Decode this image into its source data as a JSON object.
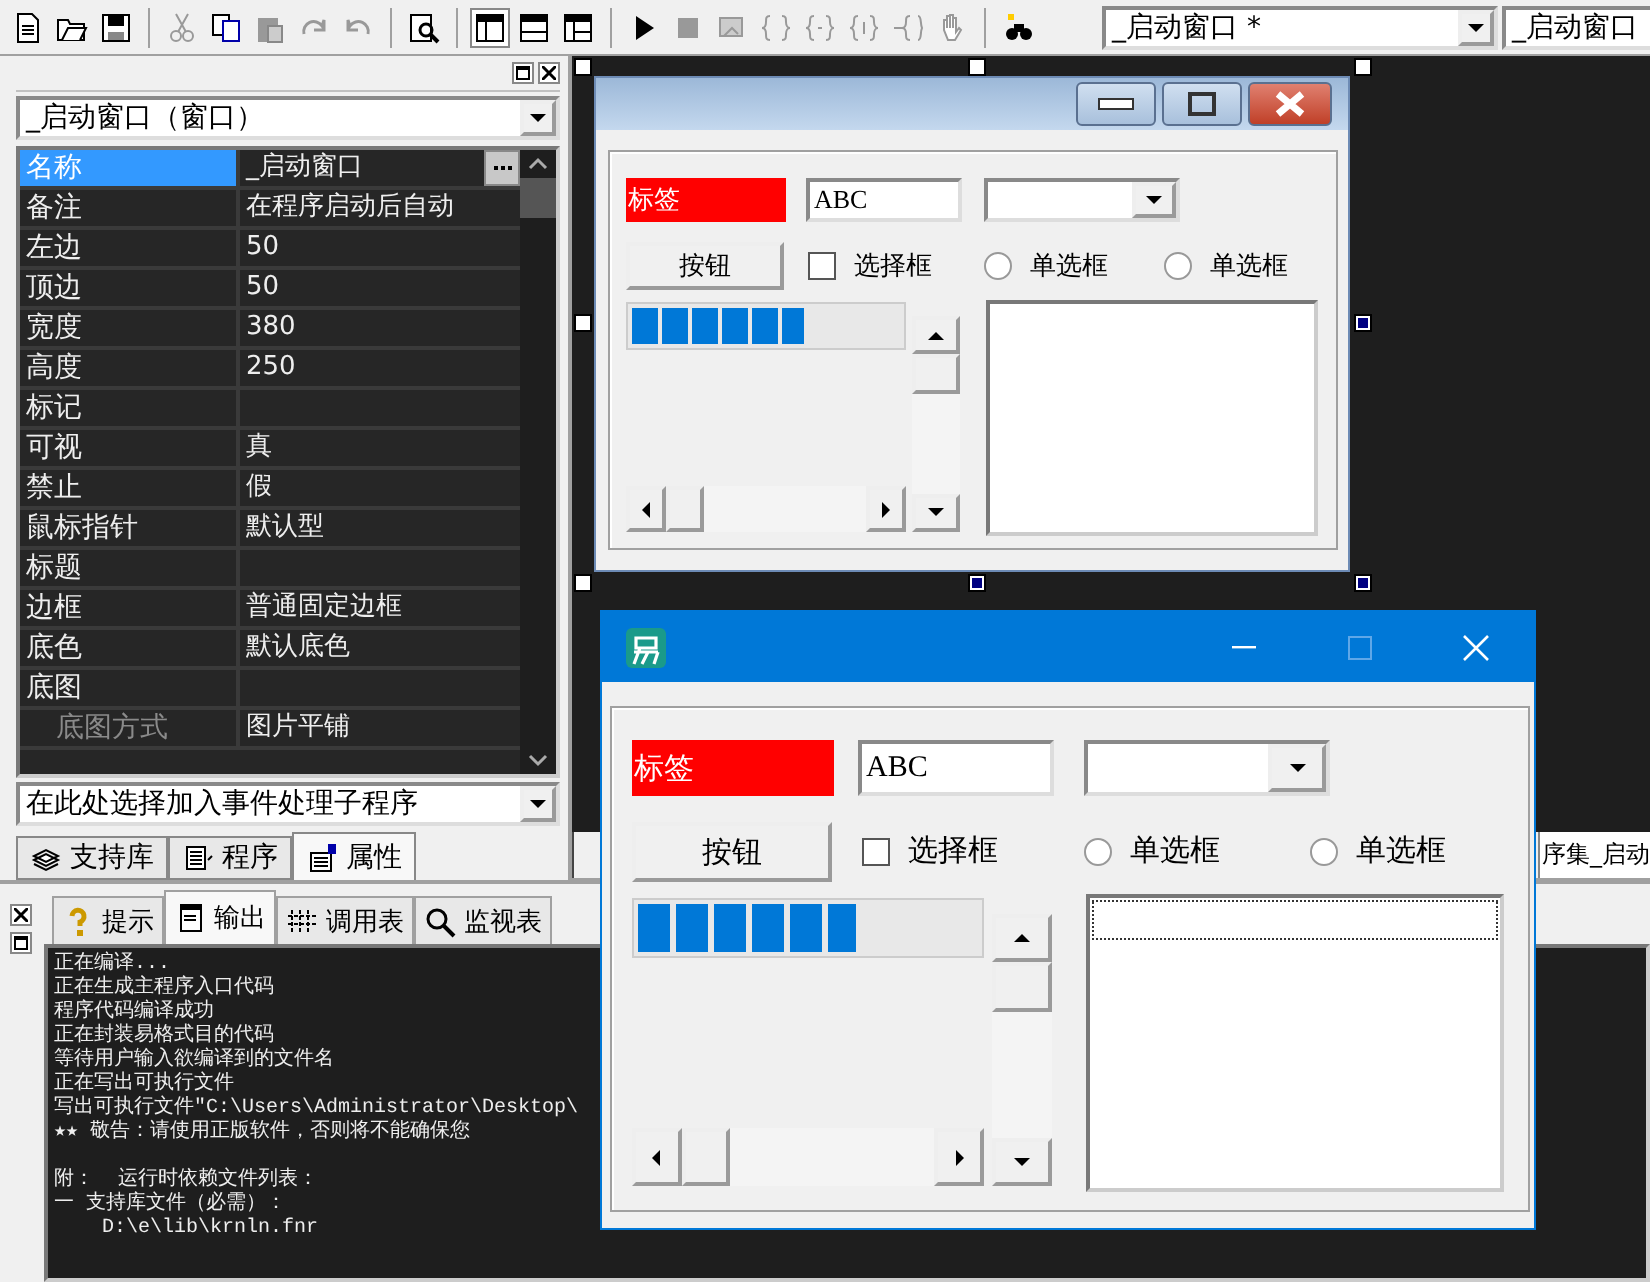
{
  "toolbar": {
    "window_selector": "_启动窗口 *",
    "object_selector": "_启动窗口"
  },
  "property_panel": {
    "object_selector": "_启动窗口（窗口）",
    "rows": [
      {
        "name": "名称",
        "value": "_启动窗口",
        "selected": true
      },
      {
        "name": "备注",
        "value": "在程序启动后自动",
        "selected": false
      },
      {
        "name": "左边",
        "value": "50",
        "selected": false
      },
      {
        "name": "顶边",
        "value": "50",
        "selected": false
      },
      {
        "name": "宽度",
        "value": "380",
        "selected": false
      },
      {
        "name": "高度",
        "value": "250",
        "selected": false
      },
      {
        "name": "标记",
        "selected": false
      },
      {
        "name": "可视",
        "value": "真",
        "selected": false
      },
      {
        "name": "禁止",
        "value": "假",
        "selected": false
      },
      {
        "name": "鼠标指针",
        "value": "默认型",
        "selected": false
      },
      {
        "name": "标题",
        "selected": false
      },
      {
        "name": "边框",
        "value": "普通固定边框",
        "selected": false
      },
      {
        "name": "底色",
        "value": "默认底色",
        "selected": false
      },
      {
        "name": "底图",
        "selected": false,
        "children": [
          {
            "name": "底图方式",
            "value": "图片平铺",
            "selected": false
          }
        ]
      }
    ],
    "event_selector": "在此处选择加入事件处理子程序"
  },
  "panel_tabs": [
    {
      "label": "支持库",
      "selected": false
    },
    {
      "label": "程序",
      "selected": false
    },
    {
      "label": "属性",
      "selected": true
    }
  ],
  "editor_tab": "序集_启动",
  "design_form": {
    "label": "标签",
    "edit_value": "ABC",
    "button": "按钮",
    "checkbox": {
      "label": "选择框",
      "checked": false
    },
    "radios": [
      {
        "label": "单选框",
        "selected": false
      },
      {
        "label": "单选框",
        "selected": false
      }
    ],
    "progress": {
      "level": 0.64
    },
    "list_focused": false
  },
  "output_panel": {
    "tabs": [
      {
        "label": "提示",
        "selected": false
      },
      {
        "label": "输出",
        "selected": true
      },
      {
        "label": "调用表",
        "selected": false
      },
      {
        "label": "监视表",
        "selected": false
      }
    ],
    "paragraphs": [
      [
        "正在编译...",
        "正在生成主程序入口代码",
        "程序代码编译成功",
        "正在封装易格式目的代码",
        "等待用户输入欲编译到的文件名",
        "正在写出可执行文件",
        "写出可执行文件\"C:\\Users\\Administrator\\Desktop\\",
        "★★ 敬告：请使用正版软件，否则将不能确保您"
      ],
      [
        "附：  运行时依赖文件列表：",
        "一 支持库文件（必需）：",
        "    D:\\e\\lib\\krnln.fnr"
      ]
    ]
  },
  "running_window": {
    "label": "标签",
    "edit_value": "ABC",
    "button": "按钮",
    "checkbox": {
      "label": "选择框",
      "checked": false
    },
    "radios": [
      {
        "label": "单选框",
        "selected": false
      },
      {
        "label": "单选框",
        "selected": false
      }
    ],
    "progress": {
      "level": 0.64
    },
    "list_focused": true
  }
}
